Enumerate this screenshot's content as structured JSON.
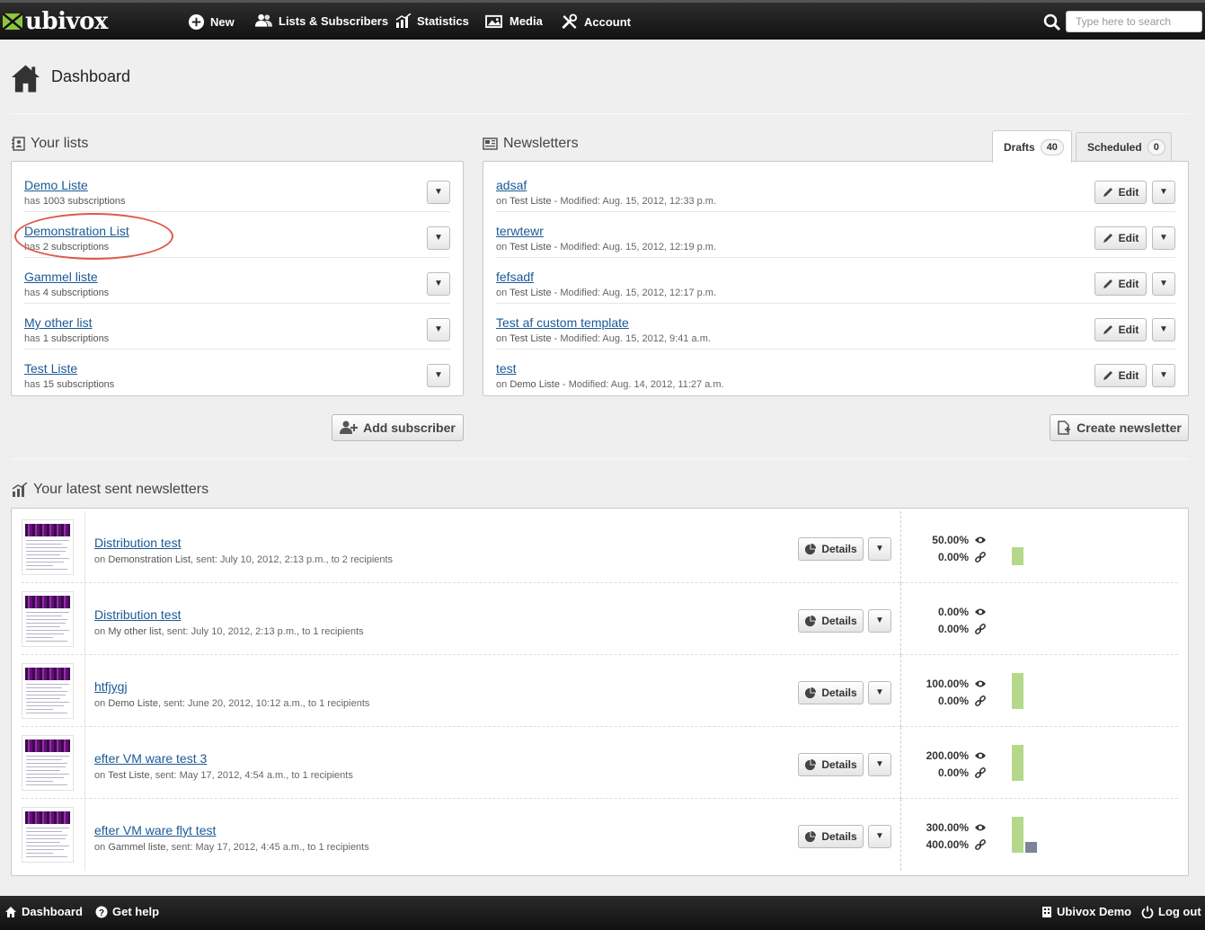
{
  "header": {
    "logo_text": "ubivox",
    "nav": [
      {
        "label": "New",
        "icon": "plus-circle-icon"
      },
      {
        "label": "Lists & Subscribers",
        "icon": "people-icon"
      },
      {
        "label": "Statistics",
        "icon": "statistics-icon"
      },
      {
        "label": "Media",
        "icon": "media-icon"
      },
      {
        "label": "Account",
        "icon": "tools-icon"
      }
    ],
    "search": {
      "placeholder": "Type here to search",
      "value": ""
    }
  },
  "page": {
    "title": "Dashboard",
    "icon": "home-icon"
  },
  "lists": {
    "title": "Your lists",
    "items": [
      {
        "name": "Demo Liste",
        "prefix": "has",
        "subs": "1003 subscriptions"
      },
      {
        "name": "Demonstration List",
        "prefix": "has",
        "subs": "2 subscriptions"
      },
      {
        "name": "Gammel liste",
        "prefix": "has",
        "subs": "4 subscriptions"
      },
      {
        "name": "My other list",
        "prefix": "has",
        "subs": "1 subscriptions"
      },
      {
        "name": "Test Liste",
        "prefix": "has",
        "subs": "15 subscriptions"
      }
    ],
    "add_button": "Add subscriber",
    "dropdown_glyph": "▼"
  },
  "newsletters": {
    "title": "Newsletters",
    "tabs": [
      {
        "label": "Drafts",
        "count": "40"
      },
      {
        "label": "Scheduled",
        "count": "0"
      }
    ],
    "items": [
      {
        "name": "adsaf",
        "on": "on",
        "list": "Test Liste",
        "modified": " - Modified: Aug. 15, 2012, 12:33 p.m."
      },
      {
        "name": "terwtewr",
        "on": "on",
        "list": "Test Liste",
        "modified": " - Modified: Aug. 15, 2012, 12:19 p.m."
      },
      {
        "name": "fefsadf",
        "on": "on",
        "list": "Test Liste",
        "modified": " - Modified: Aug. 15, 2012, 12:17 p.m."
      },
      {
        "name": "Test af custom template",
        "on": "on",
        "list": "Test Liste",
        "modified": " - Modified: Aug. 15, 2012, 9:41 a.m."
      },
      {
        "name": "test",
        "on": "on",
        "list": "Demo Liste",
        "modified": " - Modified: Aug. 14, 2012, 11:27 a.m."
      }
    ],
    "edit_label": "Edit",
    "create_button": "Create newsletter"
  },
  "sent": {
    "title": "Your latest sent newsletters",
    "details_label": "Details",
    "items": [
      {
        "name": "Distribution test",
        "on": "on",
        "list": "Demonstration List",
        "info": ", sent: July 10, 2012, 2:13 p.m., to 2 recipients",
        "opens": "50.00%",
        "clicks": "0.00%",
        "open_rate": 0.5,
        "click_rate": 0.0
      },
      {
        "name": "Distribution test",
        "on": "on",
        "list": "My other list",
        "info": ", sent: July 10, 2012, 2:13 p.m., to 1 recipients",
        "opens": "0.00%",
        "clicks": "0.00%",
        "open_rate": 0.0,
        "click_rate": 0.0
      },
      {
        "name": "htfjygj",
        "on": "on",
        "list": "Demo Liste",
        "info": ", sent: June 20, 2012, 10:12 a.m., to 1 recipients",
        "opens": "100.00%",
        "clicks": "0.00%",
        "open_rate": 1.0,
        "click_rate": 0.0
      },
      {
        "name": "efter VM ware test 3",
        "on": "on",
        "list": "Test Liste",
        "info": ", sent: May 17, 2012, 4:54 a.m., to 1 recipients",
        "opens": "200.00%",
        "clicks": "0.00%",
        "open_rate": 2.0,
        "click_rate": 0.0
      },
      {
        "name": "efter VM ware flyt test",
        "on": "on",
        "list": "Gammel liste",
        "info": ", sent: May 17, 2012, 4:45 a.m., to 1 recipients",
        "opens": "300.00%",
        "clicks": "400.00%",
        "open_rate": 3.0,
        "click_rate": 4.0
      }
    ],
    "colors": {
      "opens": "#b5d98a",
      "clicks": "#7b8796"
    }
  },
  "footer": {
    "left": [
      {
        "label": "Dashboard",
        "icon": "home-icon"
      },
      {
        "label": "Get help",
        "icon": "help-icon"
      }
    ],
    "right": [
      {
        "label": "Ubivox Demo",
        "icon": "building-icon"
      },
      {
        "label": "Log out",
        "icon": "power-icon"
      }
    ]
  }
}
